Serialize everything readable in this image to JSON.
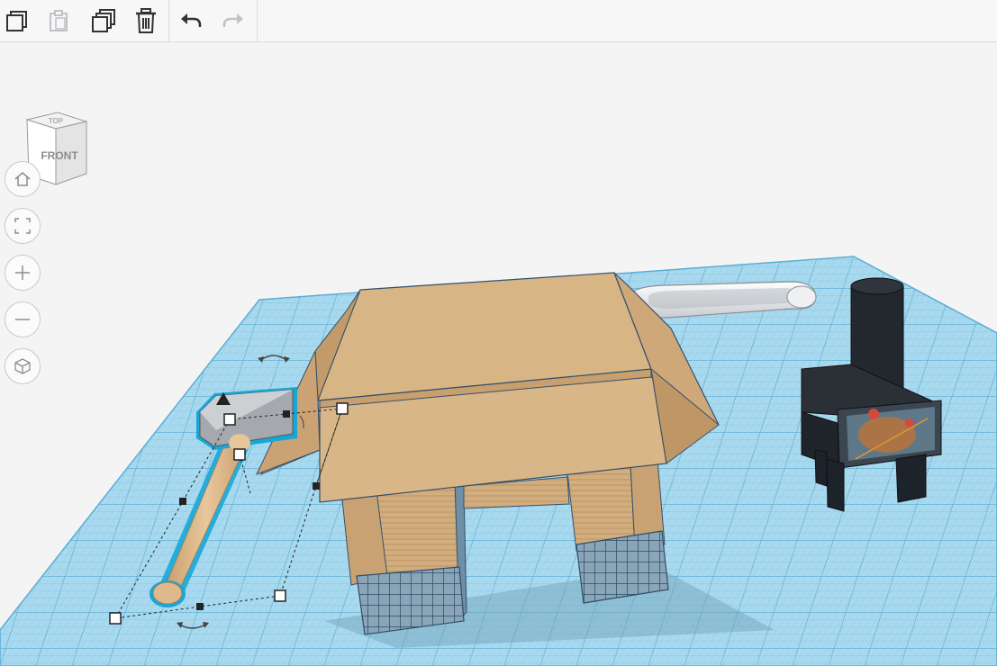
{
  "toolbar": {
    "buttons": [
      {
        "name": "copy",
        "icon": "copy-icon",
        "enabled": true
      },
      {
        "name": "paste",
        "icon": "paste-icon",
        "enabled": false
      },
      {
        "name": "duplicate",
        "icon": "duplicate-icon",
        "enabled": true
      },
      {
        "name": "delete",
        "icon": "trash-icon",
        "enabled": true
      },
      {
        "name": "undo",
        "icon": "undo-icon",
        "enabled": true
      },
      {
        "name": "redo",
        "icon": "redo-icon",
        "enabled": false
      }
    ]
  },
  "viewcube": {
    "top_label": "TOP",
    "front_label": "FRONT"
  },
  "view_controls": [
    {
      "name": "home-view",
      "icon": "home-icon"
    },
    {
      "name": "fit-all",
      "icon": "fit-icon"
    },
    {
      "name": "zoom-in",
      "icon": "plus-icon"
    },
    {
      "name": "zoom-out",
      "icon": "minus-icon"
    },
    {
      "name": "projection",
      "icon": "cube-icon"
    }
  ],
  "colors": {
    "workplane": "#9fd4ea",
    "grid_line": "#6fb8d8",
    "box": "#d6b284",
    "box_dark": "#b48f61",
    "selection": "#17a7d6",
    "heater": "#1f242a",
    "handle_wood": "#deb98e"
  }
}
